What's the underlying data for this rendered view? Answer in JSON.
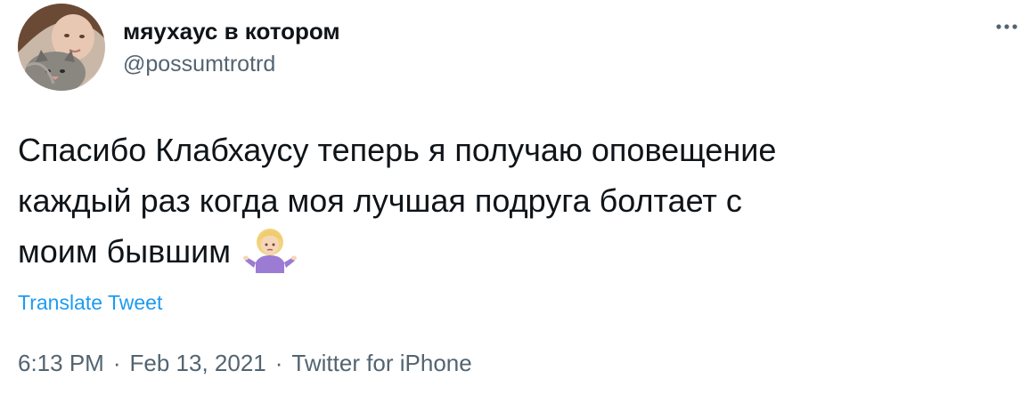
{
  "user": {
    "display_name": "мяухаус в котором",
    "handle": "@possumtrotrd"
  },
  "tweet": {
    "lines": [
      "Спасибо Клабхаусу теперь я получаю оповещение",
      "каждый раз когда моя лучшая подруга болтает с",
      "моим бывшим"
    ],
    "emoji": "person-shrugging-emoji",
    "translate_label": "Translate Tweet"
  },
  "meta": {
    "time": "6:13 PM",
    "separator": "·",
    "date": "Feb 13, 2021",
    "source": "Twitter for iPhone"
  },
  "icons": {
    "more": "more-horizontal-icon"
  },
  "colors": {
    "text": "#0f1419",
    "secondary": "#536471",
    "link": "#1d9bf0"
  }
}
